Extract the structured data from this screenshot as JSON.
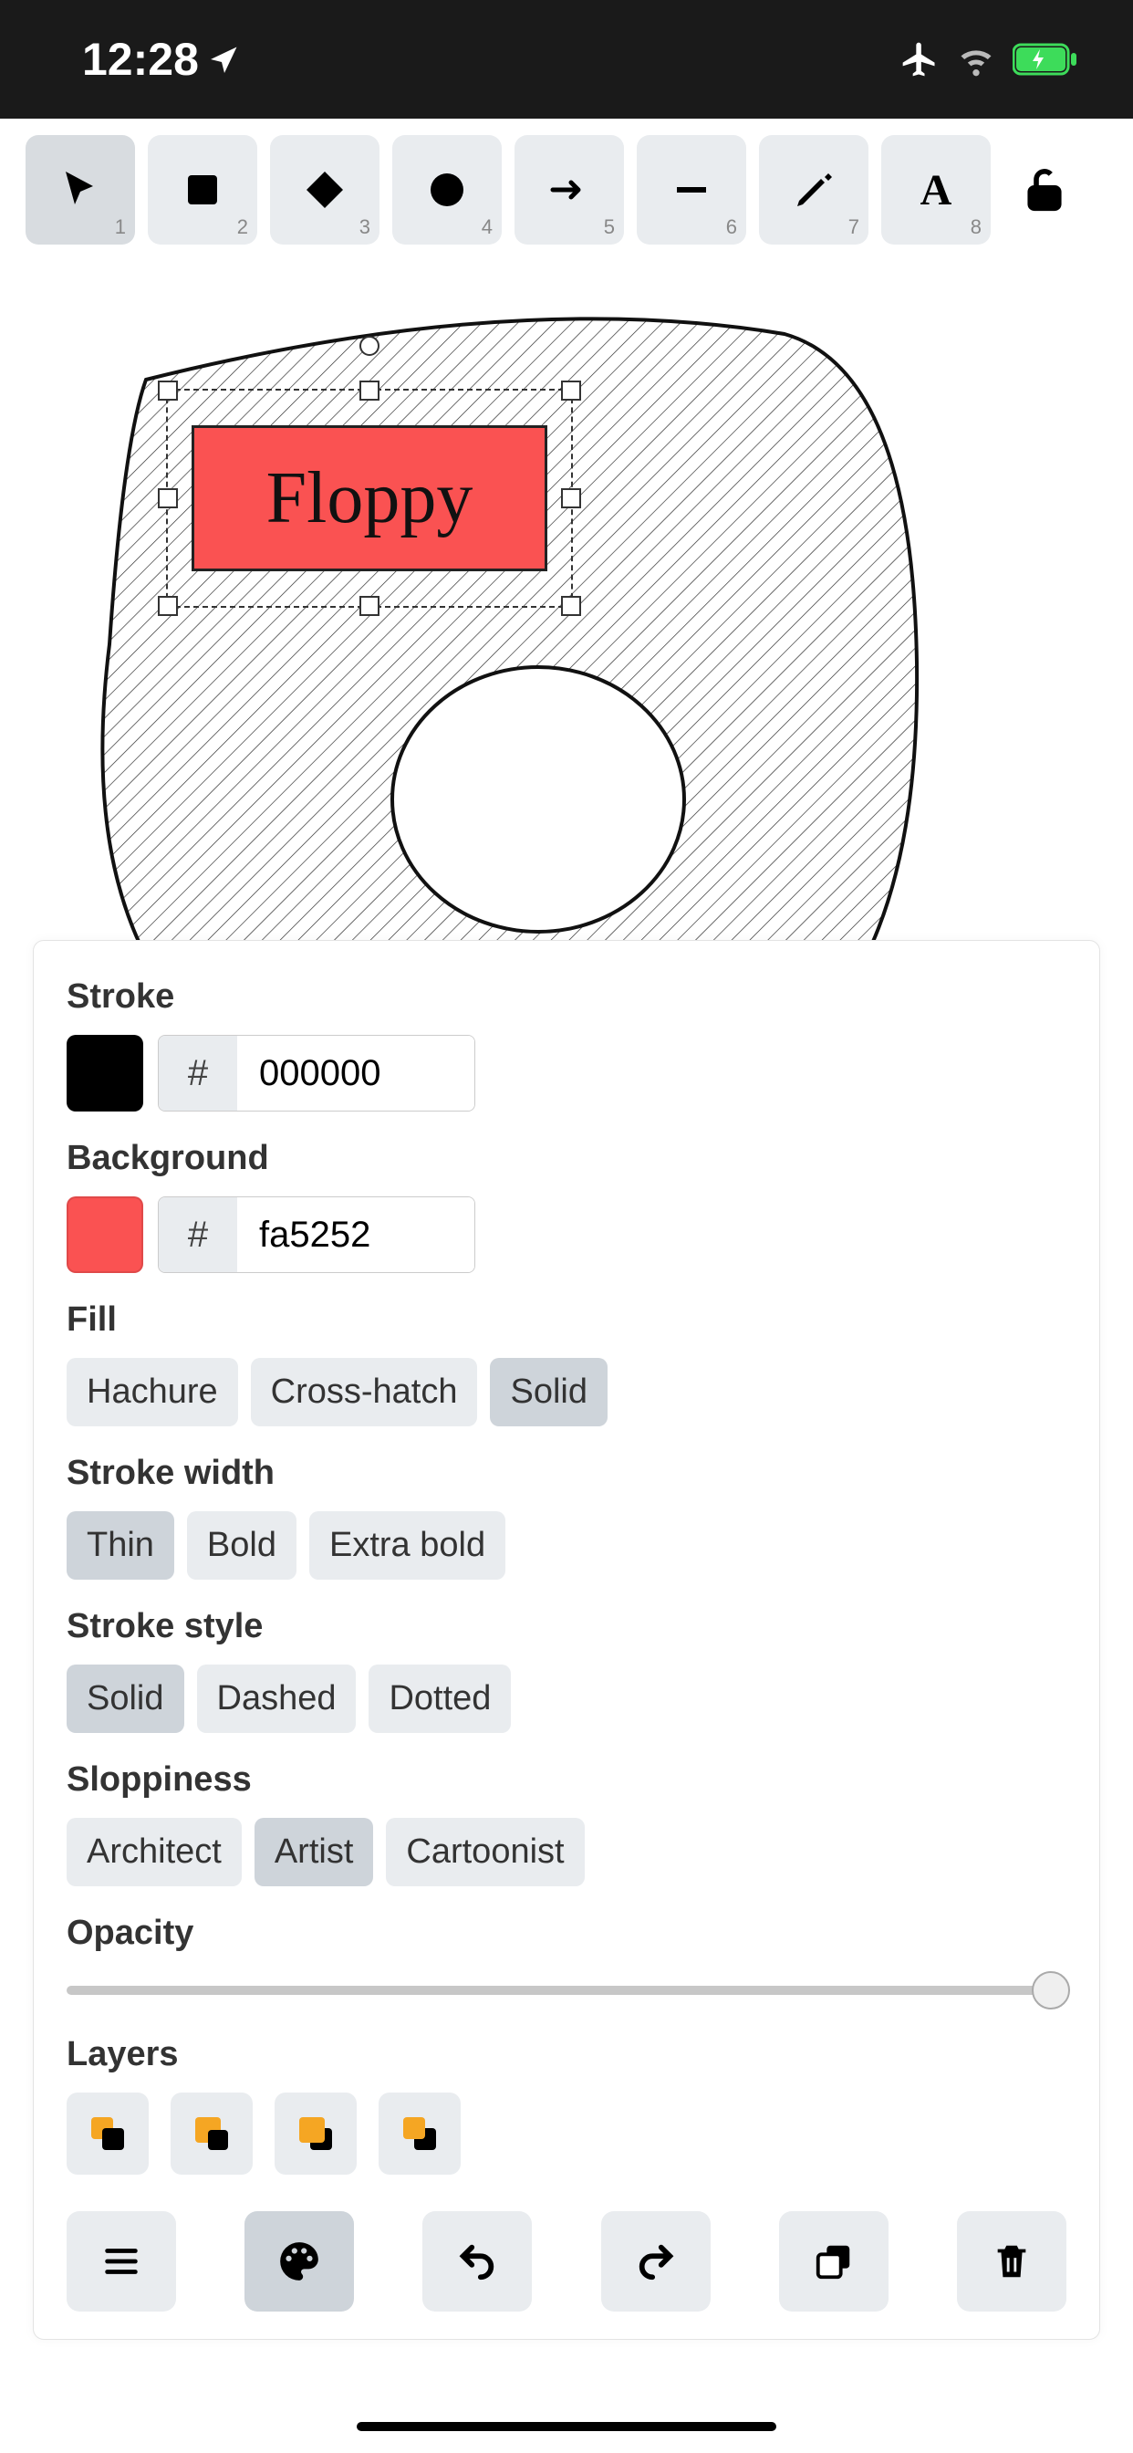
{
  "status": {
    "time": "12:28",
    "airplane": true,
    "wifi": true,
    "battery_charging": true
  },
  "tools": [
    {
      "id": "select",
      "num": "1",
      "active": true
    },
    {
      "id": "rectangle",
      "num": "2",
      "active": false
    },
    {
      "id": "diamond",
      "num": "3",
      "active": false
    },
    {
      "id": "ellipse",
      "num": "4",
      "active": false
    },
    {
      "id": "arrow",
      "num": "5",
      "active": false
    },
    {
      "id": "line",
      "num": "6",
      "active": false
    },
    {
      "id": "draw",
      "num": "7",
      "active": false
    },
    {
      "id": "text",
      "num": "8",
      "active": false
    }
  ],
  "lock": "unlocked",
  "canvas": {
    "label_text": "Floppy"
  },
  "panel": {
    "stroke": {
      "label": "Stroke",
      "hex": "000000",
      "color": "#000000"
    },
    "background": {
      "label": "Background",
      "hex": "fa5252",
      "color": "#fa5252"
    },
    "fill": {
      "label": "Fill",
      "options": [
        "Hachure",
        "Cross-hatch",
        "Solid"
      ],
      "selected": "Solid"
    },
    "stroke_width": {
      "label": "Stroke width",
      "options": [
        "Thin",
        "Bold",
        "Extra bold"
      ],
      "selected": "Thin"
    },
    "stroke_style": {
      "label": "Stroke style",
      "options": [
        "Solid",
        "Dashed",
        "Dotted"
      ],
      "selected": "Solid"
    },
    "sloppiness": {
      "label": "Sloppiness",
      "options": [
        "Architect",
        "Artist",
        "Cartoonist"
      ],
      "selected": "Artist"
    },
    "opacity": {
      "label": "Opacity",
      "value": 100
    },
    "layers": {
      "label": "Layers",
      "actions": [
        "send-to-back",
        "send-backward",
        "bring-forward",
        "bring-to-front"
      ]
    },
    "bottom_actions": [
      "menu",
      "palette",
      "undo",
      "redo",
      "duplicate",
      "delete"
    ],
    "bottom_active": "palette"
  }
}
